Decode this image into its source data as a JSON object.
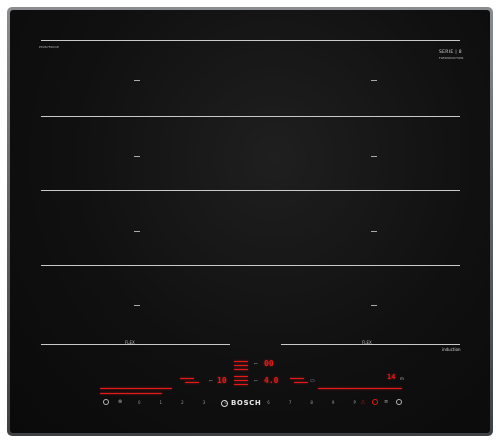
{
  "cooktop": {
    "model_label": "PXX675DC1E",
    "badge_line1": "SERIE | 8",
    "badge_line2": "FLEXINDUCTION",
    "flex_left_label": "FLEX",
    "flex_right_label": "FLEX",
    "induction_label": "induction",
    "brand": "BOSCH"
  },
  "display": {
    "timer_top": "00",
    "power_left": "10",
    "power_center": "4.0",
    "power_right": "14"
  },
  "controls": {
    "scale_marks": [
      "0",
      "1",
      "2",
      "3",
      "4",
      "5",
      "6",
      "7",
      "8",
      "9",
      "P"
    ],
    "left_icons": [
      "power-icon",
      "child-lock-icon"
    ],
    "right_icons": [
      "wipe-protection-icon",
      "timer-icon",
      "menu-icon"
    ]
  },
  "colors": {
    "glass": "#101010",
    "frame": "#6b6e71",
    "display_red": "#e01818",
    "zone_marking": "#c9c9c9"
  }
}
